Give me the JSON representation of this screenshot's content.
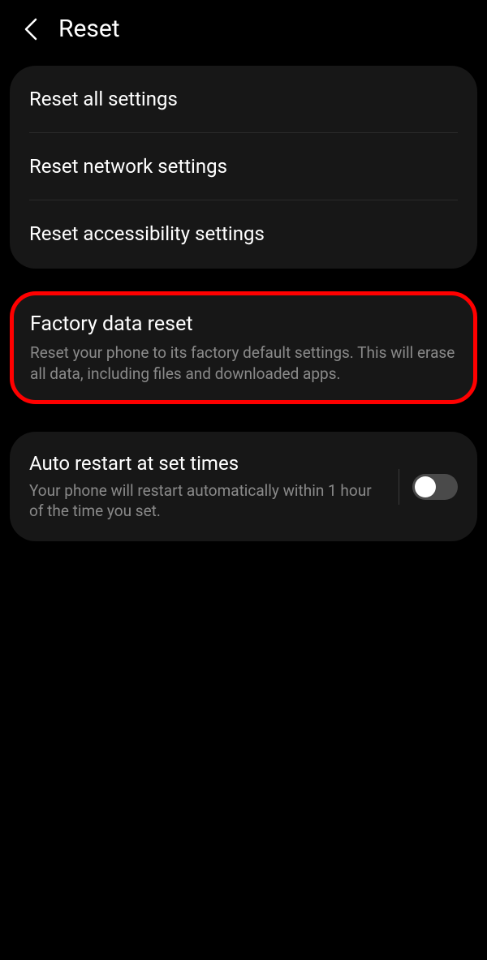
{
  "header": {
    "title": "Reset"
  },
  "section1": {
    "items": [
      {
        "title": "Reset all settings"
      },
      {
        "title": "Reset network settings"
      },
      {
        "title": "Reset accessibility settings"
      }
    ]
  },
  "section2": {
    "title": "Factory data reset",
    "subtitle": "Reset your phone to its factory default settings. This will erase all data, including files and downloaded apps."
  },
  "section3": {
    "title": "Auto restart at set times",
    "subtitle": "Your phone will restart automatically within 1 hour of the time you set.",
    "toggle": false
  }
}
